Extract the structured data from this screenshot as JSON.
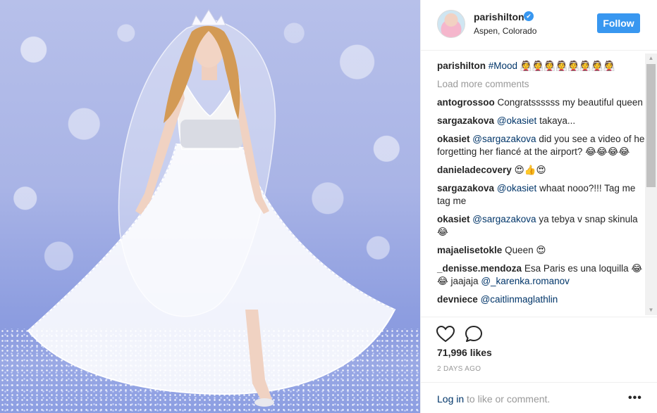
{
  "post": {
    "photo_alt": "Paris Hilton in a white wedding dress with tiara and veil on a blue bokeh background"
  },
  "header": {
    "username": "parishilton",
    "verified_icon": "✔",
    "location": "Aspen, Colorado",
    "follow_label": "Follow"
  },
  "caption": {
    "username": "parishilton",
    "text": "#Mood 👰👰👰👰👰👰👰👰"
  },
  "load_more": "Load more comments",
  "comments": [
    {
      "user": "antogrossoo",
      "text": "Congratssssss my beautiful queen"
    },
    {
      "user": "sargazakova",
      "mention": "@okasiet",
      "text": "takaya..."
    },
    {
      "user": "okasiet",
      "mention": "@sargazakova",
      "text": "did you see a video of her forgetting her fiancé at the airport? 😂😂😂😂"
    },
    {
      "user": "danieladecovery",
      "text": "😍👍😍"
    },
    {
      "user": "sargazakova",
      "mention": "@okasiet",
      "text": "whaat nooo?!!! Tag me tag me"
    },
    {
      "user": "okasiet",
      "mention": "@sargazakova",
      "text": "ya tebya v snap skinula 😂"
    },
    {
      "user": "majaelisetokle",
      "text": "Queen 😍"
    },
    {
      "user": "_denisse.mendoza",
      "text": "Esa Paris es una loquilla 😂😂 jaajaja",
      "mention_after": "@_karenka.romanov"
    },
    {
      "user": "devniece",
      "mention": "@caitlinmaglathlin",
      "text": ""
    }
  ],
  "actions": {
    "like_icon": "heart-outline",
    "comment_icon": "speech-bubble"
  },
  "likes": "71,996 likes",
  "time": "2 DAYS AGO",
  "add_comment": {
    "login_label": "Log in",
    "rest": " to like or comment.",
    "more_label": "•••"
  },
  "colors": {
    "accent": "#3897f0",
    "link": "#003569",
    "muted": "#999999",
    "text": "#262626"
  }
}
